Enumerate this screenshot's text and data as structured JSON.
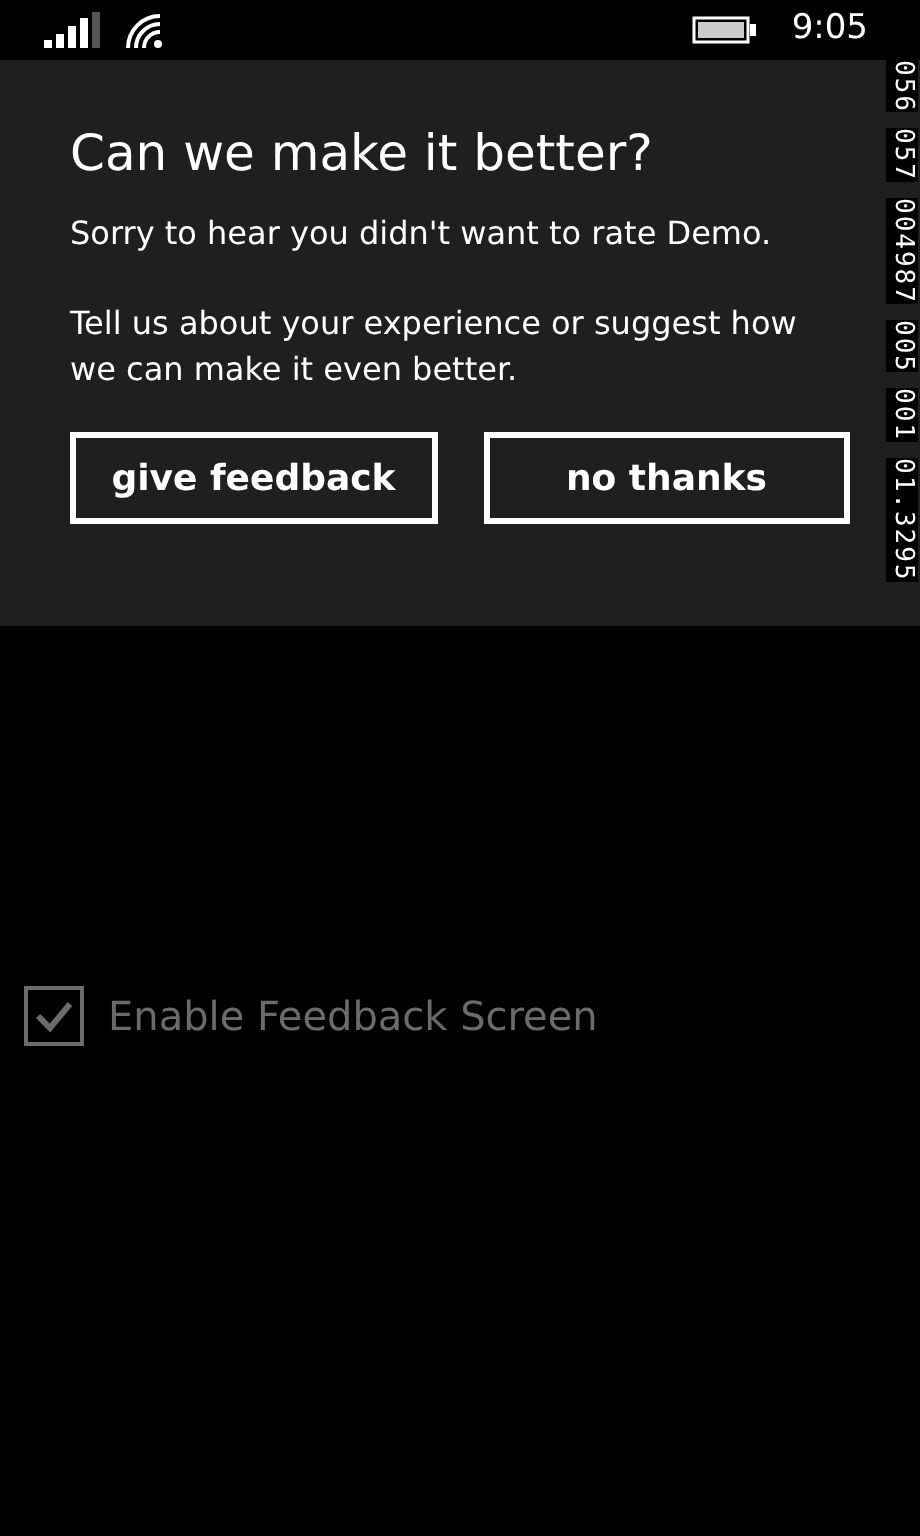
{
  "status_bar": {
    "time": "9:05"
  },
  "dialog": {
    "title": "Can we make it better?",
    "paragraphs": [
      "Sorry to hear you didn't want to rate Demo.",
      "Tell us about your experience or suggest how we can make it even better."
    ],
    "buttons": [
      "give feedback",
      "no thanks"
    ]
  },
  "checkbox": {
    "label": "Enable Feedback Screen",
    "checked": true,
    "disabled": true
  },
  "frame_counters": [
    "056",
    "057",
    "004987",
    "005",
    "001",
    "01.3295"
  ]
}
